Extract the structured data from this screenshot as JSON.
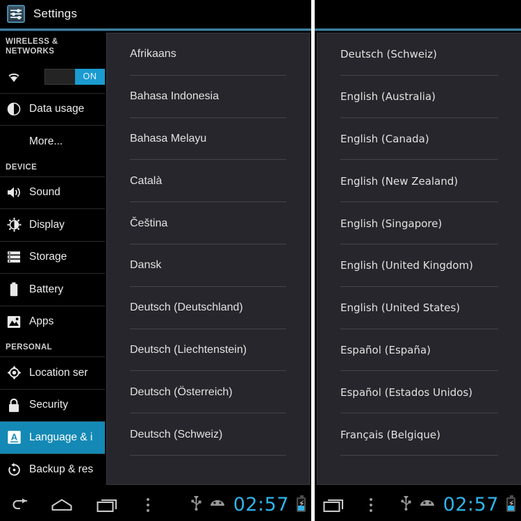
{
  "header": {
    "title": "Settings",
    "app_icon": "settings-sliders-icon"
  },
  "sidebar": {
    "sections": [
      {
        "label": "WIRELESS &\nNETWORKS"
      },
      {
        "label": "DEVICE"
      },
      {
        "label": "PERSONAL"
      }
    ],
    "section_wireless": "WIRELESS &",
    "section_wireless2": "NETWORKS",
    "section_device": "DEVICE",
    "section_personal": "PERSONAL",
    "wifi": {
      "icon": "wifi-icon",
      "toggle_state": "ON"
    },
    "items": [
      {
        "label": "Data usage",
        "icon": "data-usage-icon",
        "selected": false
      },
      {
        "label": "More...",
        "icon": "none",
        "selected": false
      },
      {
        "label": "Sound",
        "icon": "sound-icon",
        "selected": false
      },
      {
        "label": "Display",
        "icon": "display-brightness-icon",
        "selected": false
      },
      {
        "label": "Storage",
        "icon": "storage-icon",
        "selected": false
      },
      {
        "label": "Battery",
        "icon": "battery-icon",
        "selected": false
      },
      {
        "label": "Apps",
        "icon": "apps-image-icon",
        "selected": false
      },
      {
        "label": "Location ser",
        "icon": "location-icon",
        "selected": false
      },
      {
        "label": "Security",
        "icon": "lock-icon",
        "selected": false
      },
      {
        "label": "Language & i",
        "icon": "language-keyboard-icon",
        "selected": true
      },
      {
        "label": "Backup & res",
        "icon": "backup-restore-icon",
        "selected": false
      }
    ]
  },
  "language_list_center": [
    "Afrikaans",
    "Bahasa Indonesia",
    "Bahasa Melayu",
    "Català",
    "Čeština",
    "Dansk",
    "Deutsch (Deutschland)",
    "Deutsch (Liechtenstein)",
    "Deutsch (Österreich)",
    "Deutsch (Schweiz)"
  ],
  "language_list_right": [
    "Deutsch (Schweiz)",
    "English (Australia)",
    "English (Canada)",
    "English (New Zealand)",
    "English (Singapore)",
    "English (United Kingdom)",
    "English (United States)",
    "Español (España)",
    "Español (Estados Unidos)",
    "Français (Belgique)"
  ],
  "navbar_left": {
    "back": "back-icon",
    "home": "home-icon",
    "recents": "recent-apps-icon",
    "menu": "overflow-menu-icon",
    "usb": "usb-icon",
    "android": "android-robot-icon",
    "clock": "02:57",
    "battery": "battery-charging-icon"
  },
  "navbar_right": {
    "recents": "recent-apps-icon",
    "menu": "overflow-menu-icon",
    "usb": "usb-icon",
    "android": "android-robot-icon",
    "clock": "02:57",
    "battery": "battery-charging-icon"
  },
  "colors": {
    "accent_blue": "#1489b5",
    "clock_blue": "#2fb4e9",
    "panel_bg": "#26262c",
    "screen_bg": "#000000"
  }
}
